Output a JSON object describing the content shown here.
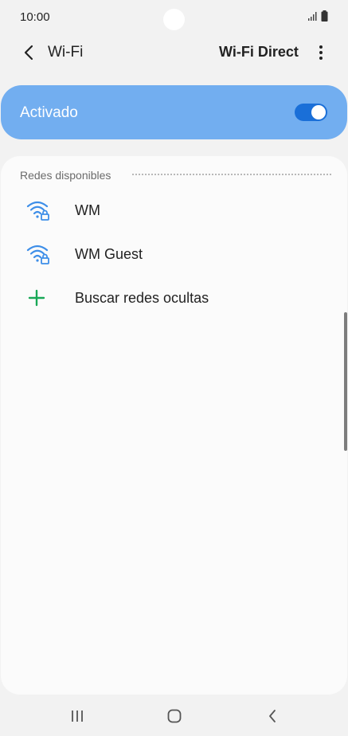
{
  "status_bar": {
    "time": "10:00",
    "icons": [
      "signal-icon",
      "battery-icon"
    ]
  },
  "app_bar": {
    "title": "Wi-Fi",
    "action_label": "Wi-Fi Direct",
    "icons": [
      "back-arrow-icon",
      "more-options-icon"
    ]
  },
  "toggle": {
    "label": "Activado",
    "state": "on",
    "accent_color": "#72aef0",
    "switch_color": "#1a6fd8"
  },
  "networks": {
    "section_title": "Redes disponibles",
    "items": [
      {
        "label": "WM",
        "icon": "wifi-locked-icon"
      },
      {
        "label": "WM Guest",
        "icon": "wifi-locked-icon"
      },
      {
        "label": "Buscar redes ocultas",
        "icon": "plus-icon"
      }
    ]
  },
  "nav_bar": {
    "icons": [
      "recent-apps-icon",
      "home-icon",
      "back-icon"
    ]
  },
  "colors": {
    "wifi_icon": "#3d8ee8",
    "plus_icon": "#19a857",
    "background": "#f2f2f2"
  }
}
